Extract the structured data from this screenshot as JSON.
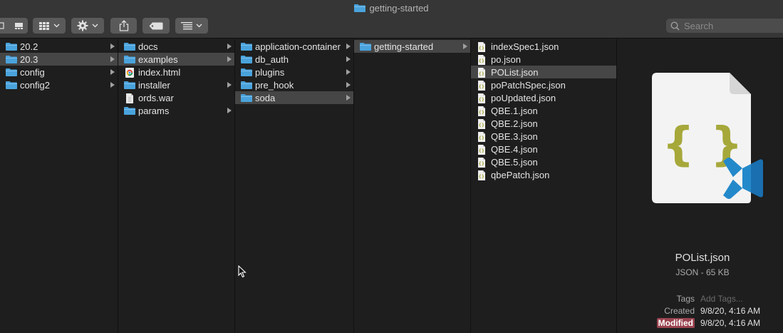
{
  "window": {
    "title": "getting-started"
  },
  "toolbar": {
    "buttons": [
      {
        "name": "view-mode-button"
      },
      {
        "name": "group-button"
      },
      {
        "name": "action-button"
      },
      {
        "name": "share-button"
      },
      {
        "name": "tags-button"
      },
      {
        "name": "sort-button"
      }
    ],
    "search_placeholder": "Search"
  },
  "columns": [
    {
      "items": [
        {
          "label": "20.2",
          "type": "folder",
          "arrow": true,
          "selected": false
        },
        {
          "label": "20.3",
          "type": "folder",
          "arrow": true,
          "selected": true
        },
        {
          "label": "config",
          "type": "folder",
          "arrow": true,
          "selected": false
        },
        {
          "label": "config2",
          "type": "folder",
          "arrow": true,
          "selected": false
        }
      ]
    },
    {
      "items": [
        {
          "label": "docs",
          "type": "folder",
          "arrow": true,
          "selected": false
        },
        {
          "label": "examples",
          "type": "folder",
          "arrow": true,
          "selected": true
        },
        {
          "label": "index.html",
          "type": "html",
          "arrow": false,
          "selected": false
        },
        {
          "label": "installer",
          "type": "folder",
          "arrow": true,
          "selected": false
        },
        {
          "label": "ords.war",
          "type": "war",
          "arrow": false,
          "selected": false
        },
        {
          "label": "params",
          "type": "folder",
          "arrow": true,
          "selected": false
        }
      ]
    },
    {
      "items": [
        {
          "label": "application-container",
          "type": "folder",
          "arrow": true,
          "selected": false
        },
        {
          "label": "db_auth",
          "type": "folder",
          "arrow": true,
          "selected": false
        },
        {
          "label": "plugins",
          "type": "folder",
          "arrow": true,
          "selected": false
        },
        {
          "label": "pre_hook",
          "type": "folder",
          "arrow": true,
          "selected": false
        },
        {
          "label": "soda",
          "type": "folder",
          "arrow": true,
          "selected": true
        }
      ]
    },
    {
      "items": [
        {
          "label": "getting-started",
          "type": "folder",
          "arrow": true,
          "selected": true
        }
      ]
    },
    {
      "items": [
        {
          "label": "indexSpec1.json",
          "type": "json",
          "arrow": false,
          "selected": false
        },
        {
          "label": "po.json",
          "type": "json",
          "arrow": false,
          "selected": false
        },
        {
          "label": "POList.json",
          "type": "json",
          "arrow": false,
          "selected": true
        },
        {
          "label": "poPatchSpec.json",
          "type": "json",
          "arrow": false,
          "selected": false
        },
        {
          "label": "poUpdated.json",
          "type": "json",
          "arrow": false,
          "selected": false
        },
        {
          "label": "QBE.1.json",
          "type": "json",
          "arrow": false,
          "selected": false
        },
        {
          "label": "QBE.2.json",
          "type": "json",
          "arrow": false,
          "selected": false
        },
        {
          "label": "QBE.3.json",
          "type": "json",
          "arrow": false,
          "selected": false
        },
        {
          "label": "QBE.4.json",
          "type": "json",
          "arrow": false,
          "selected": false
        },
        {
          "label": "QBE.5.json",
          "type": "json",
          "arrow": false,
          "selected": false
        },
        {
          "label": "qbePatch.json",
          "type": "json",
          "arrow": false,
          "selected": false
        }
      ]
    }
  ],
  "preview": {
    "name": "POList.json",
    "kind": "JSON - 65 KB",
    "tags_label": "Tags",
    "tags_placeholder": "Add Tags...",
    "created_label": "Created",
    "created_value": "9/8/20, 4:16 AM",
    "modified_label": "Modified",
    "modified_value": "9/8/20, 4:16 AM",
    "icon_glyph": "{ }"
  },
  "colors": {
    "folder": "#4aa3dc",
    "selection": "#464646",
    "modified_highlight": "#9a4350",
    "json_braces": "#a6a83a",
    "vscode_blue": "#2489ca"
  }
}
